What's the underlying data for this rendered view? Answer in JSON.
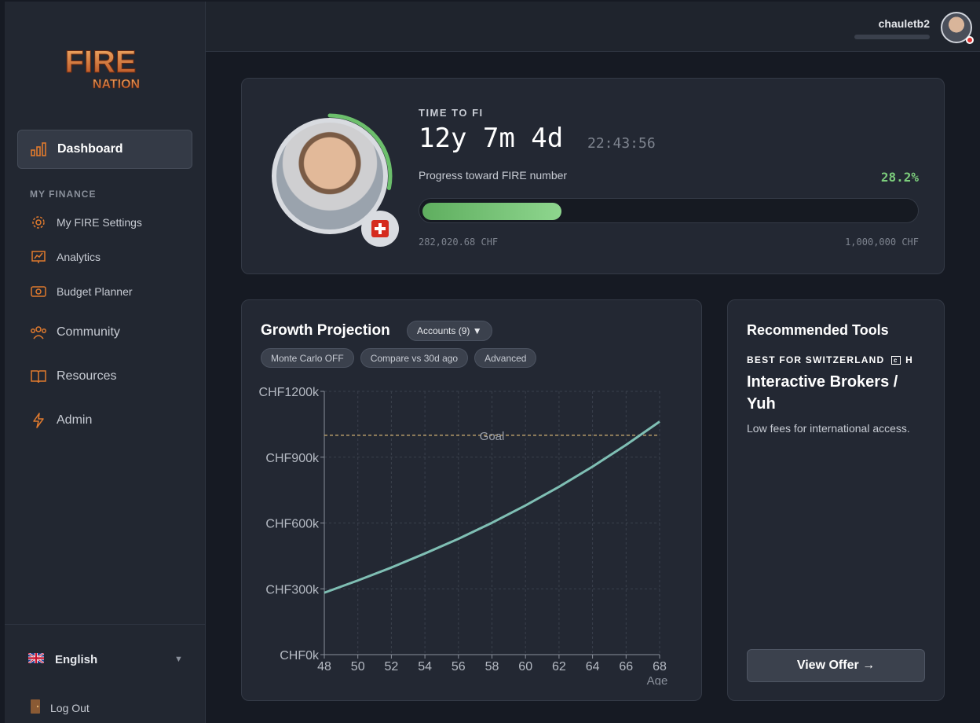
{
  "brand": {
    "logo_main": "FIRE",
    "logo_sub": "NATION",
    "accent": "#e07a2e"
  },
  "user": {
    "name": "chauletb2"
  },
  "sidebar": {
    "dashboard": "Dashboard",
    "section_label": "MY FINANCE",
    "items": [
      {
        "label": "My FIRE Settings",
        "icon": "gear-icon"
      },
      {
        "label": "Analytics",
        "icon": "chart-board-icon"
      },
      {
        "label": "Budget Planner",
        "icon": "wallet-icon"
      },
      {
        "label": "Community",
        "icon": "people-icon"
      },
      {
        "label": "Resources",
        "icon": "book-icon"
      },
      {
        "label": "Admin",
        "icon": "bolt-icon"
      }
    ],
    "language": "English",
    "logout": "Log Out"
  },
  "fi": {
    "label": "TIME TO FI",
    "time": "12y 7m 4d",
    "clock": "22:43:56",
    "progress_label": "Progress toward FIRE number",
    "progress_pct_text": "28.2%",
    "progress_fraction": 0.282,
    "current": "282,020.68 CHF",
    "target": "1,000,000 CHF"
  },
  "growth": {
    "title": "Growth Projection",
    "accounts_btn": "Accounts (9) ▼",
    "pills": [
      "Monte Carlo OFF",
      "Compare vs 30d ago",
      "Advanced"
    ]
  },
  "chart_data": {
    "type": "line",
    "xlabel": "Age",
    "ylabel": "",
    "x": [
      48,
      50,
      52,
      54,
      56,
      58,
      60,
      62,
      64,
      66,
      68
    ],
    "series": [
      {
        "values": [
          282,
          338,
          397,
          461,
          528,
          601,
          680,
          765,
          857,
          956,
          1062
        ]
      }
    ],
    "goal": {
      "label": "Goal",
      "value": 1000
    },
    "xticks": [
      "48",
      "50",
      "52",
      "54",
      "56",
      "58",
      "60",
      "62",
      "64",
      "66",
      "68"
    ],
    "yticks": [
      "CHF0k",
      "CHF300k",
      "CHF600k",
      "CHF900k",
      "CHF1200k"
    ],
    "ytick_values": [
      0,
      300,
      600,
      900,
      1200
    ],
    "ylim": [
      0,
      1200
    ],
    "xlim": [
      48,
      68
    ],
    "grid": true,
    "line_color": "#7fbfb4",
    "goal_color": "#b59a6a"
  },
  "tools": {
    "title": "Recommended Tools",
    "best": "BEST FOR SWITZERLAND",
    "best_suffix": "H",
    "name": "Interactive Brokers / Yuh",
    "desc": "Low fees for international access.",
    "offer": "View Offer →"
  }
}
